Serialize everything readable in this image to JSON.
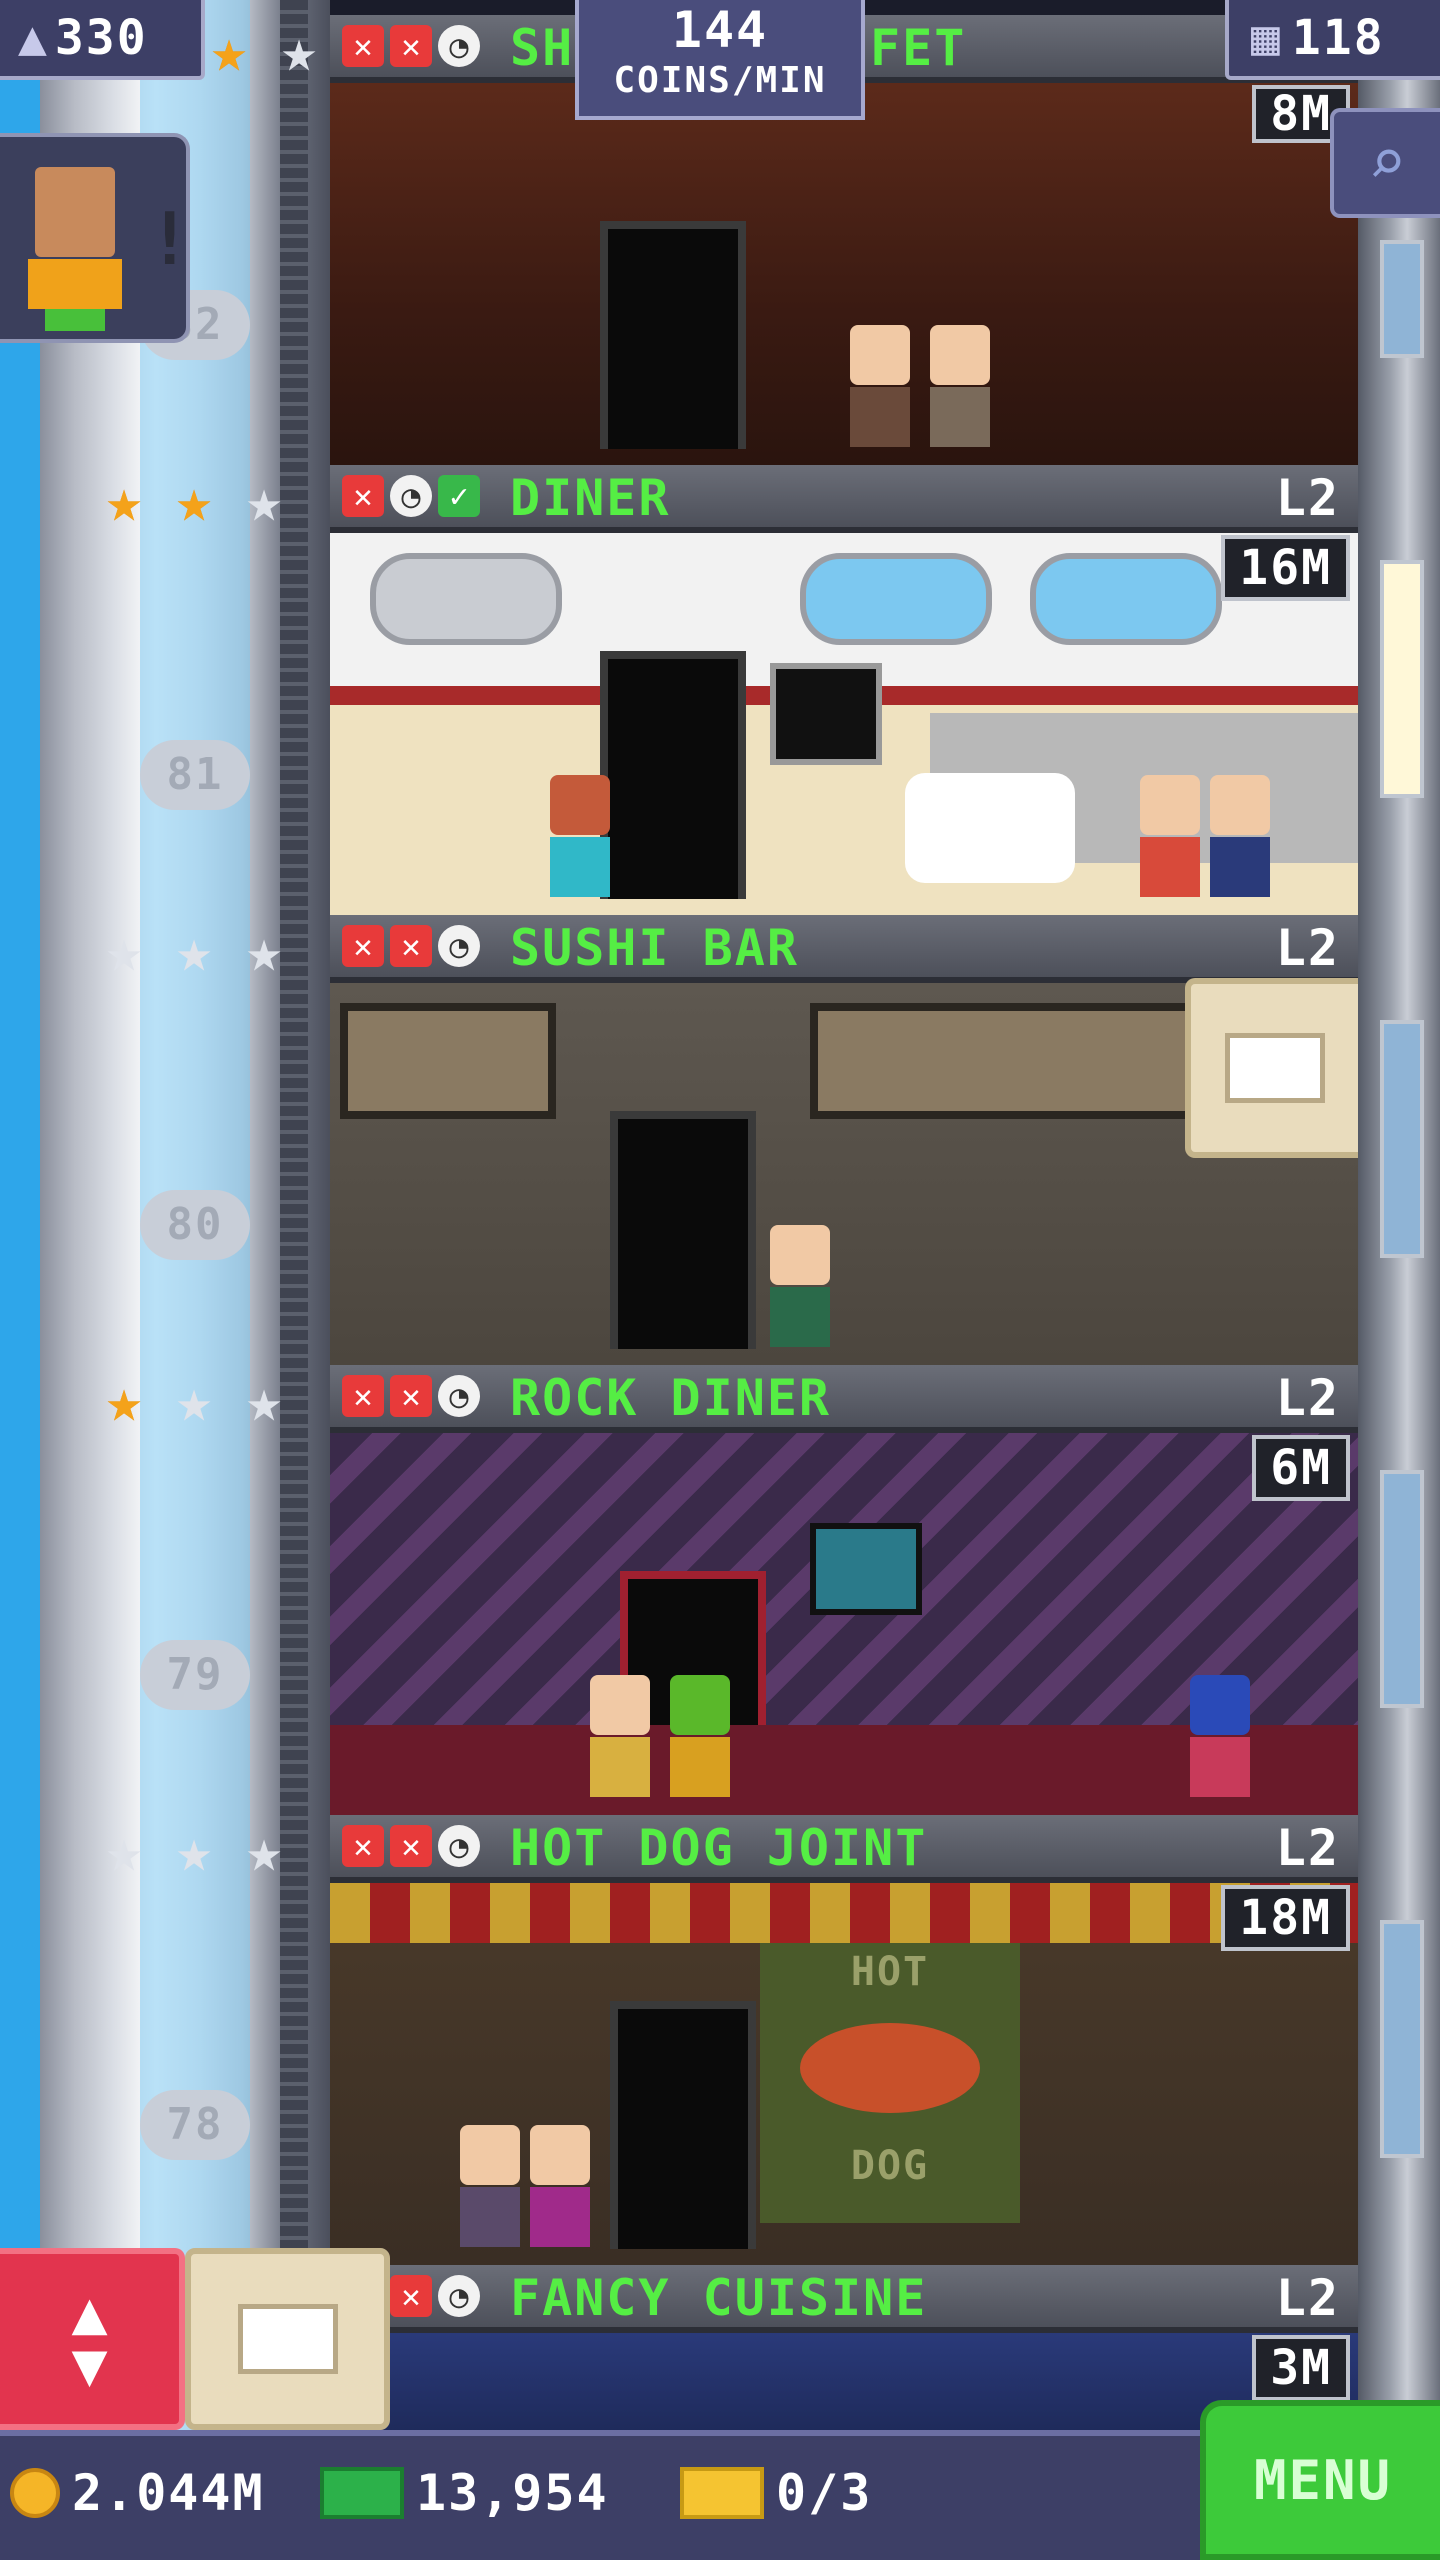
{
  "hud": {
    "population": "330",
    "coins_per_min_value": "144",
    "coins_per_min_unit": "COINS/MIN",
    "floors": "118",
    "partial_floor_time": "8M"
  },
  "floor_numbers": [
    "82",
    "81",
    "80",
    "79",
    "78"
  ],
  "floors": [
    {
      "name_left": "SH",
      "name_right": "FET",
      "level": "",
      "time": "8M"
    },
    {
      "name": "DINER",
      "level": "L2",
      "time": "16M"
    },
    {
      "name": "SUSHI BAR",
      "level": "L2",
      "time": ""
    },
    {
      "name": "ROCK DINER",
      "level": "L2",
      "time": "6M"
    },
    {
      "name": "HOT DOG JOINT",
      "level": "L2",
      "time": "18M"
    },
    {
      "name": "FANCY CUISINE",
      "level": "L2",
      "time": "3M"
    }
  ],
  "room_signs": {
    "hot": "HOT",
    "dog": "DOG"
  },
  "bottom_bar": {
    "coins": "2.044M",
    "tower_bux": "13,954",
    "tickets": "0/3",
    "menu_label": "MENU"
  },
  "colors": {
    "floor_name_green": "#55ee44",
    "hud_purple": "#3d3f66",
    "menu_green": "#3dca3a",
    "elevator_red": "#e2344e"
  }
}
